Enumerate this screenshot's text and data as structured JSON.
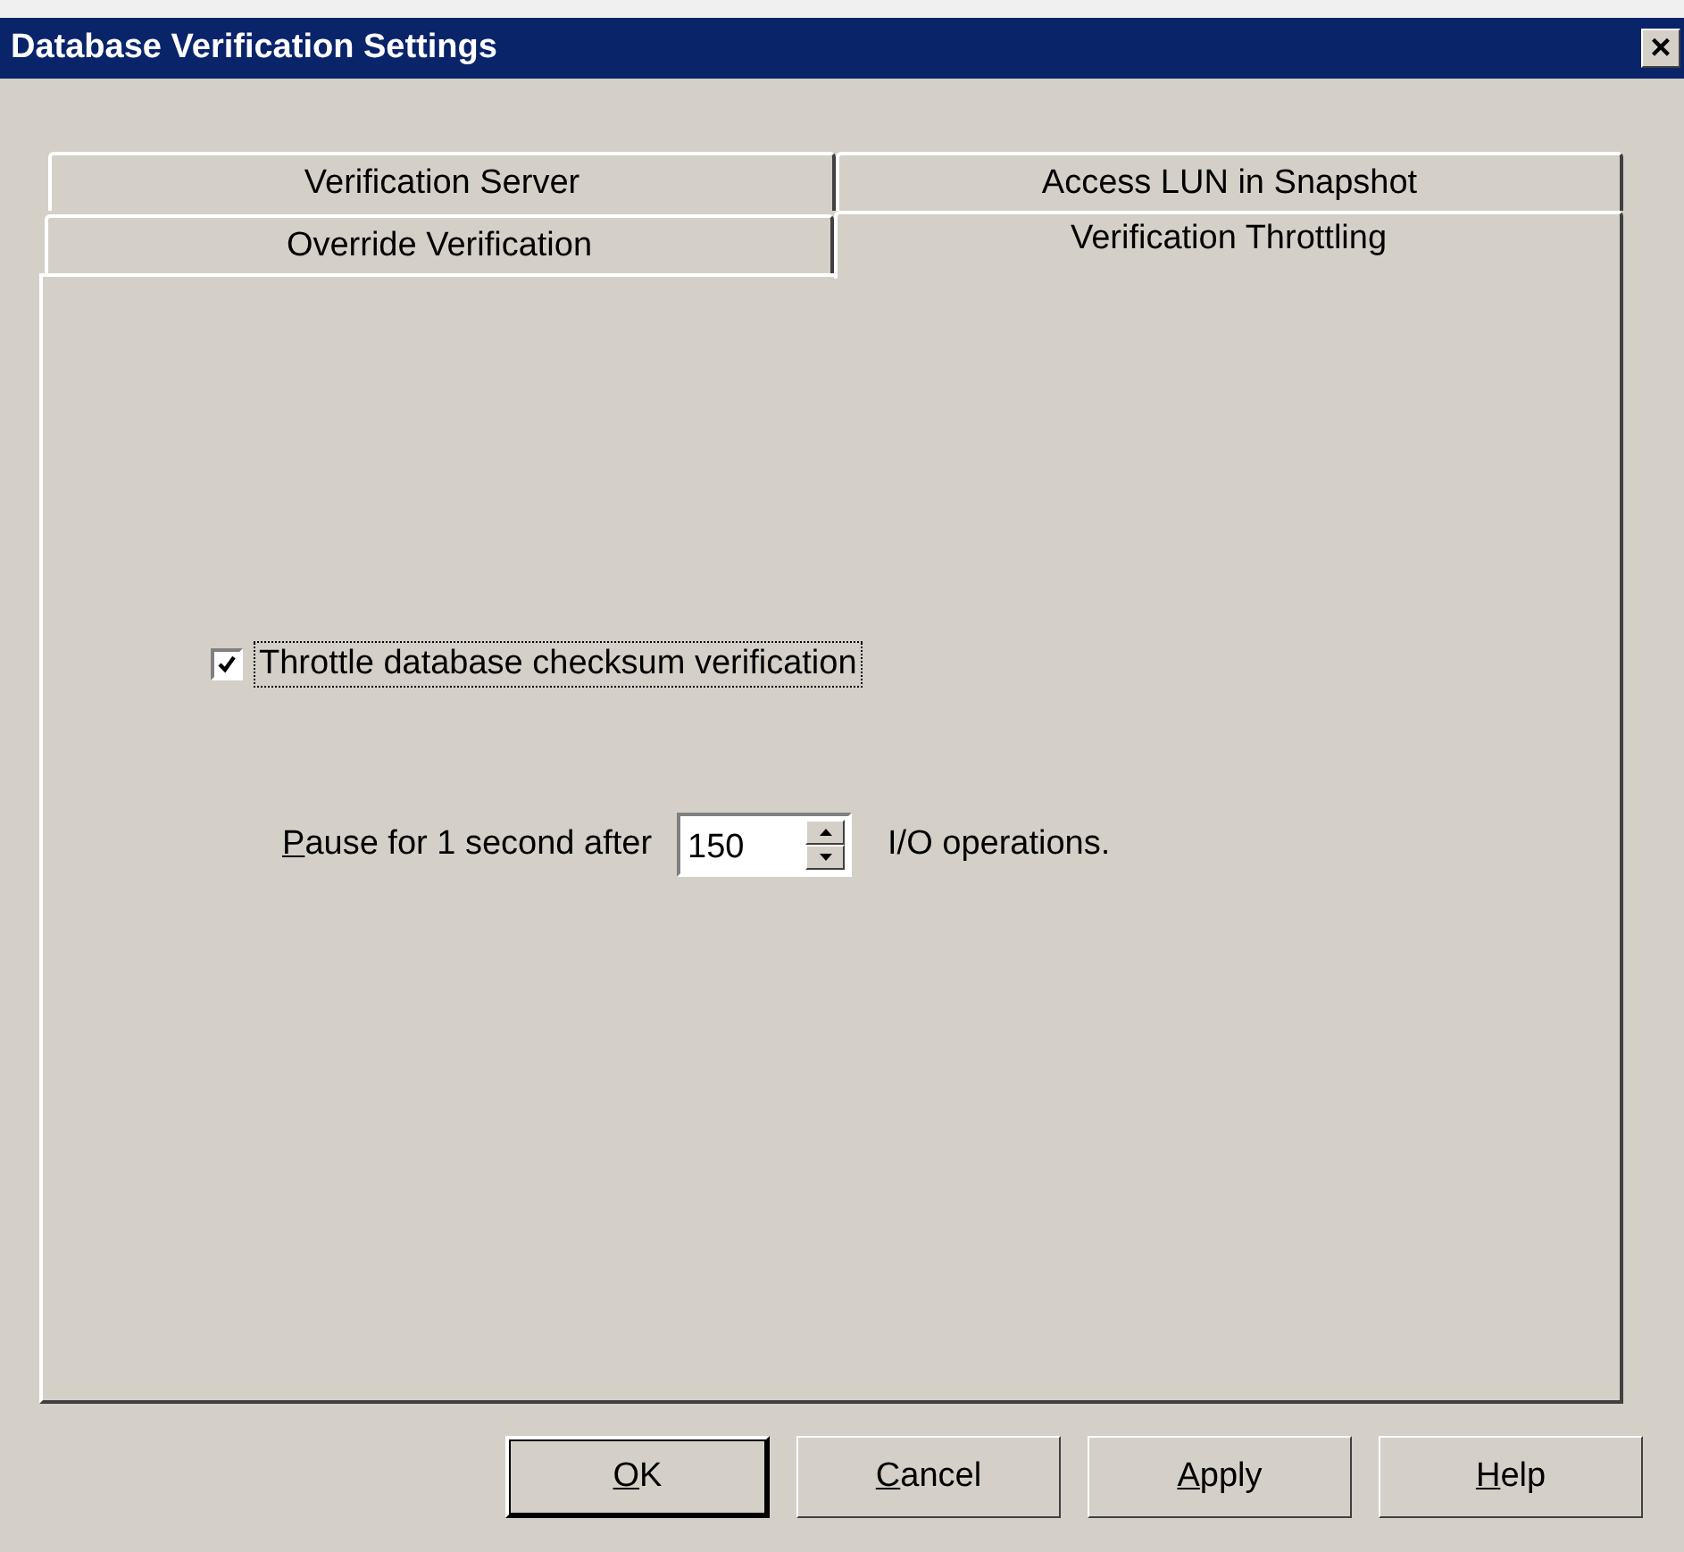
{
  "window": {
    "title": "Database Verification Settings",
    "close": "×"
  },
  "tab_rows": [
    [
      {
        "label": "Verification Server",
        "selected": false
      },
      {
        "label": "Access LUN in Snapshot",
        "selected": false
      }
    ],
    [
      {
        "label": "Override Verification",
        "selected": false
      },
      {
        "label": "Verification Throttling",
        "selected": true
      }
    ]
  ],
  "throttle": {
    "label": "Throttle database checksum verification",
    "checked": true,
    "focused": true
  },
  "pause": {
    "label": {
      "key": "P",
      "rest": "ause for 1 second after"
    },
    "value": "150",
    "suffix": "I/O operations."
  },
  "buttons": [
    {
      "key": "O",
      "rest": "K",
      "default": true
    },
    {
      "key": "C",
      "rest": "ancel",
      "default": false
    },
    {
      "key": "A",
      "rest": "pply",
      "default": false
    },
    {
      "key": "H",
      "rest": "elp",
      "default": false
    }
  ]
}
